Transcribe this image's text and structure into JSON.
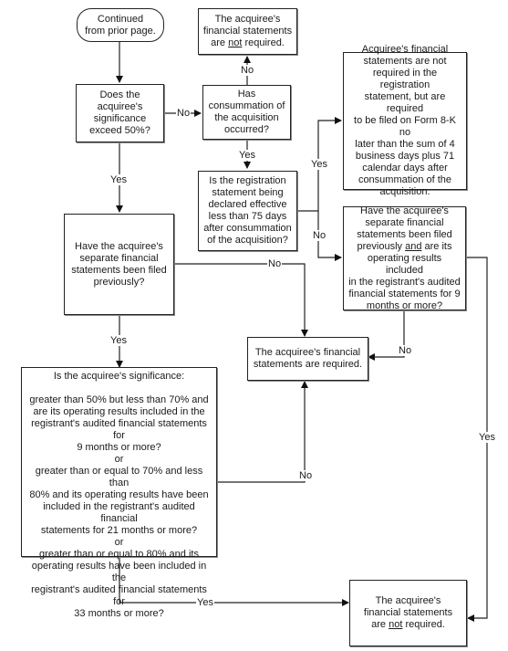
{
  "nodes": {
    "start": "Continued\nfrom prior page.",
    "q_exceed50": "Does the\nacquiree's\nsignificance\nexceed 50%?",
    "q_consummation": "Has\nconsummation of\nthe acquisition\noccurred?",
    "not_required_top": {
      "pre": "The acquiree's\nfinancial statements\nare ",
      "emph": "not",
      "post": " required."
    },
    "q_effective75": "Is the registration\nstatement being\ndeclared effective\nless than 75 days\nafter consummation\nof the acquisition?",
    "form8k": "Acquiree's financial\nstatements are not\nrequired in the registration\nstatement, but are required\nto be filed on Form 8-K no\nlater than the sum of 4\nbusiness days plus 71\ncalendar days after\nconsummation of the\nacquisition.",
    "q_filed_prev": "Have the acquiree's\nseparate financial\nstatements been filed\npreviously?",
    "q_filed_and_9mo": {
      "pre": "Have the acquiree's\nseparate financial\nstatements been filed\npreviously ",
      "emph": "and",
      "post": " are its\noperating results included\nin the registrant's audited\nfinancial statements for 9\nmonths or more?"
    },
    "required": "The acquiree's financial\nstatements are required.",
    "q_significance": {
      "heading": "Is the acquiree's significance:",
      "opt1": "greater than 50% but less than 70% and\nare its operating results included in the\nregistrant's audited financial statements for\n9 months or more?",
      "or1": "or",
      "opt2": "greater than or equal to 70% and less than\n80% and its operating results have been\nincluded in the registrant's audited financial\nstatements for 21 months or more?",
      "or2": "or",
      "opt3": "greater than or equal to 80% and its\noperating results have been included in the\nregistrant's audited financial statements for\n33 months or more?"
    },
    "not_required_bottom": {
      "pre": "The acquiree's\nfinancial statements\nare ",
      "emph": "not",
      "post": " required."
    }
  },
  "labels": {
    "no_exceed": "No",
    "yes_exceed": "Yes",
    "no_consum": "No",
    "yes_consum": "Yes",
    "yes_effective": "Yes",
    "no_effective": "No",
    "no_filed_prev": "No",
    "yes_filed_prev": "Yes",
    "no_filed_9mo": "No",
    "yes_filed_9mo": "Yes",
    "no_signif": "No",
    "yes_signif": "Yes"
  }
}
